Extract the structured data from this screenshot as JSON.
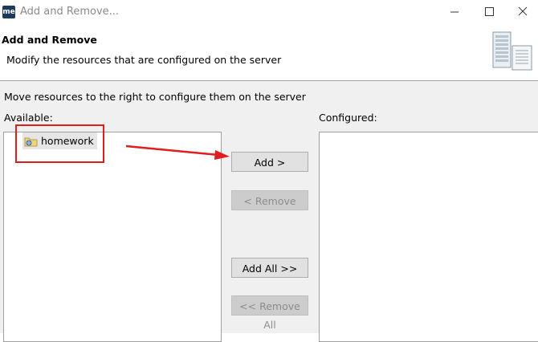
{
  "window": {
    "app_icon_text": "me",
    "title": "Add and Remove..."
  },
  "header": {
    "title": "Add and Remove",
    "description": "Modify the resources that are configured on the server"
  },
  "instruction": "Move resources to the right to configure them on the server",
  "available": {
    "label": "Available:",
    "items": [
      {
        "label": "homework",
        "icon": "web-project-icon",
        "selected": true
      }
    ]
  },
  "configured": {
    "label": "Configured:",
    "items": []
  },
  "buttons": {
    "add": {
      "label": "Add >",
      "enabled": true
    },
    "remove": {
      "label": "< Remove",
      "enabled": false
    },
    "add_all": {
      "label": "Add All >>",
      "enabled": true
    },
    "remove_all": {
      "label": "<< Remove All",
      "enabled": false
    }
  },
  "annotation": {
    "color": "#e11d1d",
    "shape": "red rectangle around homework with arrow pointing to Add button"
  },
  "colors": {
    "panel_bg": "#f0f0f0",
    "list_bg": "#ffffff",
    "disabled_text": "#8d8d8d"
  }
}
